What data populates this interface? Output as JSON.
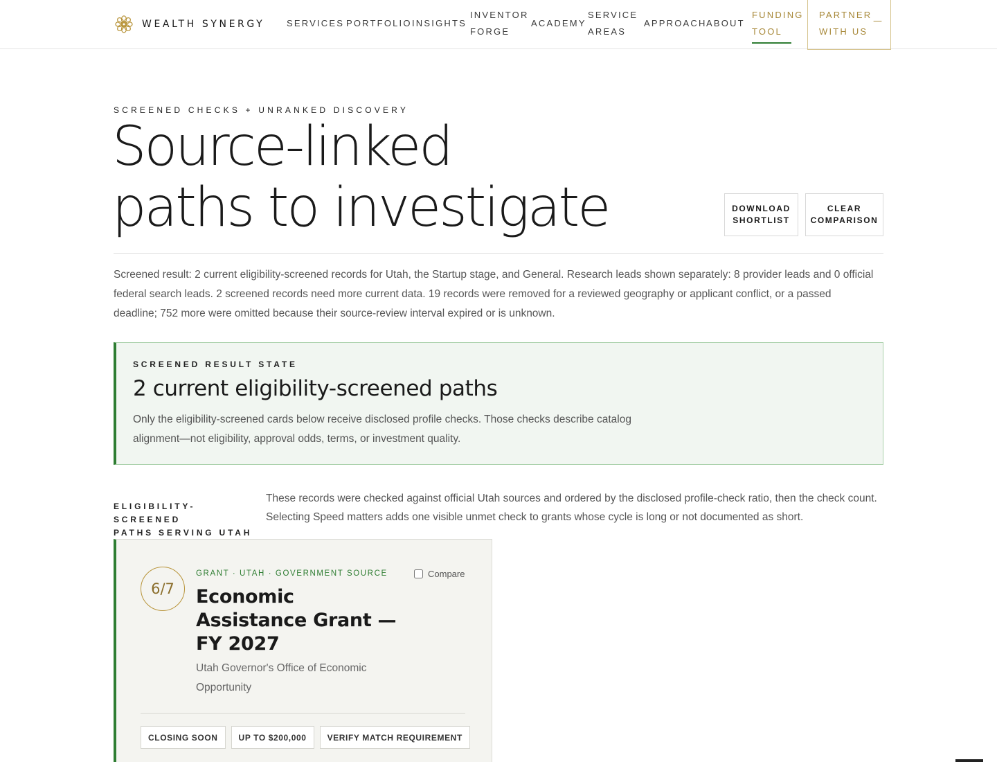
{
  "brand": {
    "name": "WEALTH SYNERGY",
    "accent": "#b8943a",
    "green": "#2e7d32"
  },
  "nav": {
    "services": "SERVICES",
    "portfolio": "PORTFOLIO",
    "insights": "INSIGHTS",
    "inventor_forge": [
      "INVENTOR",
      "FORGE"
    ],
    "academy": "ACADEMY",
    "service_areas": [
      "SERVICE",
      "AREAS"
    ],
    "approach": "APPROACH",
    "about": "ABOUT",
    "funding_tool": [
      "FUNDING",
      "TOOL"
    ],
    "partner": [
      "PARTNER",
      "WITH US"
    ],
    "partner_dash": "—"
  },
  "hero": {
    "eyebrow": "SCREENED CHECKS + UNRANKED DISCOVERY",
    "title_line1": "Source-linked",
    "title_line2": "paths to investigate",
    "download_label": "DOWNLOAD\nSHORTLIST",
    "clear_label": "CLEAR\nCOMPARISON"
  },
  "summary": "Screened result: 2 current eligibility-screened records for Utah, the Startup stage, and General. Research leads shown separately: 8 provider leads and 0 official federal search leads. 2 screened records need more current data. 19 records were removed for a reviewed geography or applicant conflict, or a passed deadline; 752 more were omitted because their source-review interval expired or is unknown.",
  "state": {
    "eyebrow": "SCREENED RESULT STATE",
    "title": "2 current eligibility-screened paths",
    "desc": "Only the eligibility-screened cards below receive disclosed profile checks. Those checks describe catalog alignment—not eligibility, approval odds, terms, or investment quality."
  },
  "section": {
    "label": [
      "ELIGIBILITY-SCREENED",
      "PATHS SERVING UTAH"
    ],
    "desc": "These records were checked against official Utah sources and ordered by the disclosed profile-check ratio, then the check count. Selecting Speed matters adds one visible unmet check to grants whose cycle is long or not documented as short."
  },
  "card": {
    "score": "6/7",
    "tag": "GRANT · UTAH · GOVERNMENT SOURCE",
    "compare_label": "Compare",
    "title": "Economic Assistance Grant — FY 2027",
    "org": "Utah Governor's Office of Economic Opportunity",
    "chips": [
      "CLOSING SOON",
      "UP TO $200,000",
      "VERIFY MATCH REQUIREMENT"
    ]
  }
}
